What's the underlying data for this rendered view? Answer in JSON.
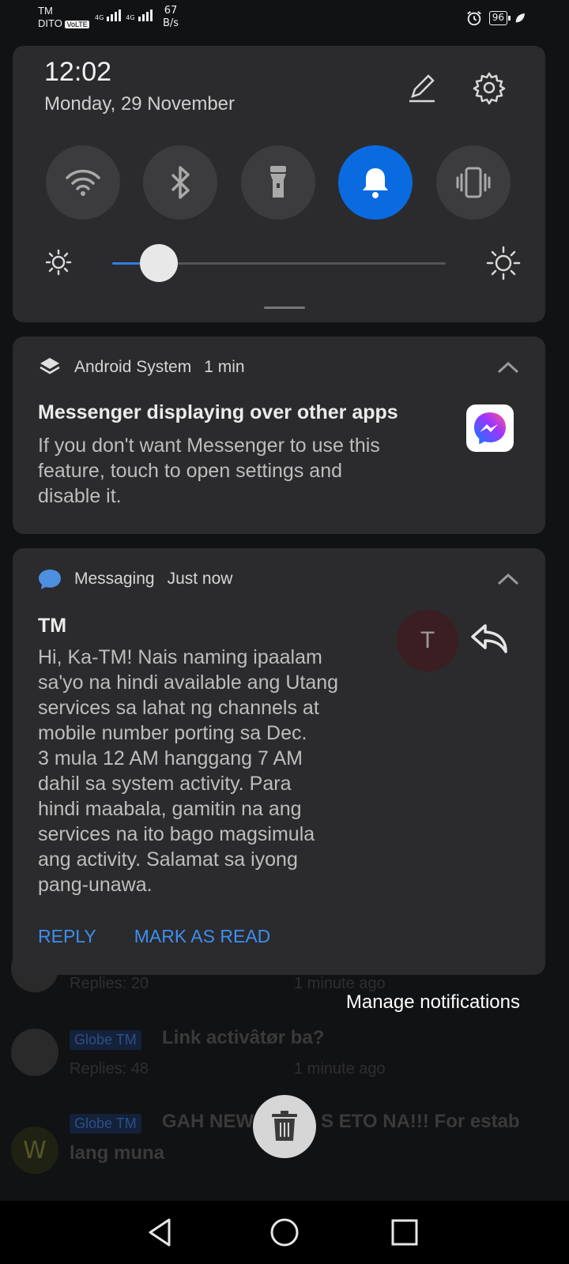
{
  "status_bar": {
    "carrier_top": "TM",
    "carrier_bottom": "DITO",
    "volte": "VoLTE",
    "net1": "4G",
    "net2": "4G",
    "speed_value": "67",
    "speed_unit": "B/s",
    "battery": "96"
  },
  "quick_settings": {
    "time": "12:02",
    "date": "Monday, 29 November",
    "toggles": [
      {
        "name": "wifi",
        "active": false
      },
      {
        "name": "bluetooth",
        "active": false
      },
      {
        "name": "flashlight",
        "active": false
      },
      {
        "name": "sound",
        "active": true
      },
      {
        "name": "vibrate",
        "active": false
      }
    ],
    "brightness_level": 0.14,
    "accent_color": "#0a6be0"
  },
  "notifications": [
    {
      "app": "Android System",
      "time": "1 min",
      "title": "Messenger displaying over other apps",
      "body": [
        "If you don't want Messenger to use this",
        "feature, touch to open settings and",
        "disable it."
      ]
    },
    {
      "app": "Messaging",
      "time": "Just now",
      "sender": "TM",
      "avatar_letter": "T",
      "body": [
        "Hi, Ka-TM! Nais naming ipaalam",
        "sa'yo na hindi available ang Utang",
        "services sa lahat ng channels at",
        "mobile number porting sa Dec.",
        "3 mula 12 AM hanggang 7 AM",
        "dahil sa system activity. Para",
        "hindi maabala, gamitin na ang",
        "services na ito bago magsimula",
        "ang activity. Salamat sa iyong",
        "pang-unawa."
      ],
      "actions": [
        "REPLY",
        "MARK AS READ"
      ]
    }
  ],
  "manage_notifications": "Manage notifications",
  "background_app": {
    "rows": [
      {
        "tag": "",
        "title": "",
        "meta_left": "Replies: 20",
        "meta_right": "1 minute ago"
      },
      {
        "tag": "Globe TM",
        "title": "Link activâtør ba?",
        "meta_left": "Replies: 48",
        "meta_right": "1 minute ago"
      },
      {
        "tag": "Globe TM",
        "title": "GAH NEW",
        "title_end": "S ETO NA!!! For estab",
        "title_line2": "lang muna",
        "avatar_letter": "W"
      }
    ]
  }
}
